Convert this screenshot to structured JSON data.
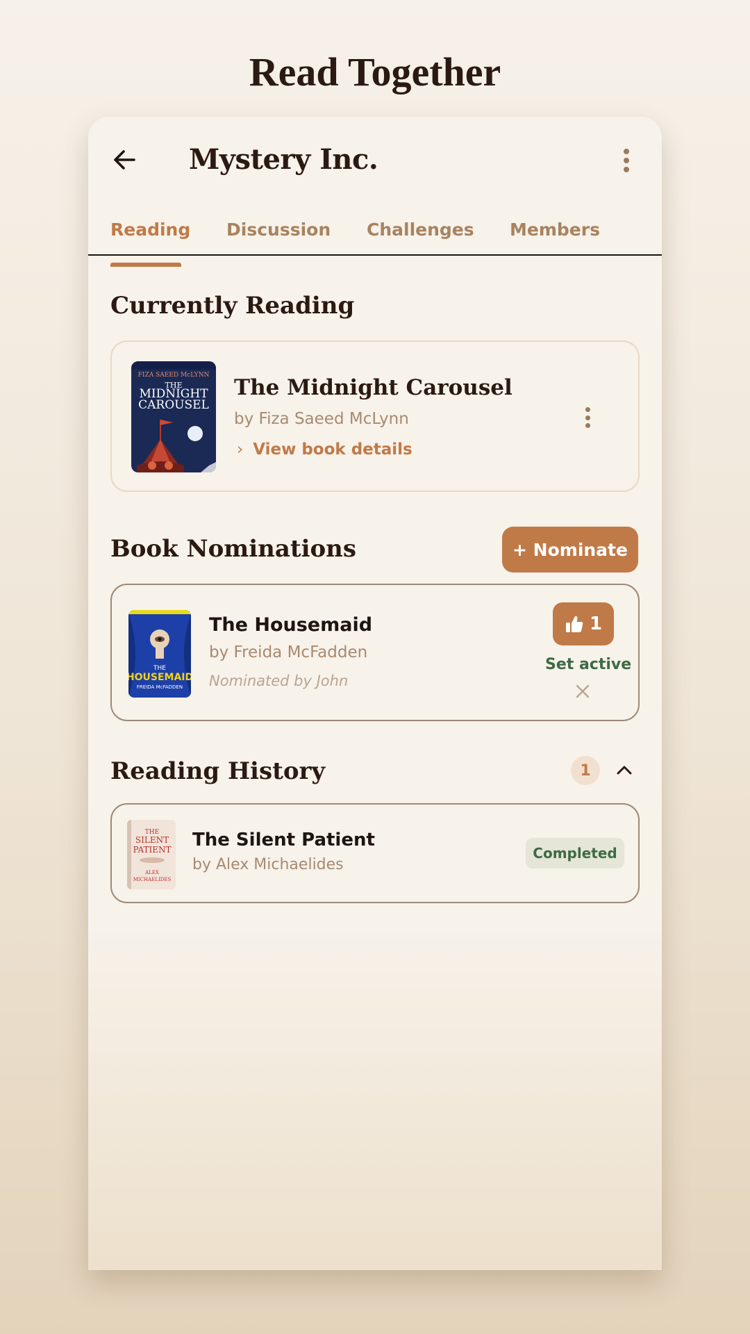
{
  "page": {
    "title": "Read Together"
  },
  "appbar": {
    "group_name": "Mystery Inc."
  },
  "tabs": [
    {
      "label": "Reading",
      "active": true
    },
    {
      "label": "Discussion",
      "active": false
    },
    {
      "label": "Challenges",
      "active": false
    },
    {
      "label": "Members",
      "active": false
    }
  ],
  "currently_reading": {
    "section_title": "Currently Reading",
    "book": {
      "title": "The Midnight Carousel",
      "author": "by Fiza Saeed McLynn",
      "details_link": "View book details",
      "cover": {
        "author_text": "FIZA SAEED McLYNN",
        "title_line1": "THE",
        "title_line2": "MIDNIGHT",
        "title_line3": "CAROUSEL"
      }
    }
  },
  "nominations": {
    "section_title": "Book Nominations",
    "nominate_label": "+ Nominate",
    "items": [
      {
        "title": "The Housemaid",
        "author": "by Freida McFadden",
        "nominated_by": "Nominated by John",
        "votes": "1",
        "set_active_label": "Set active",
        "cover": {
          "title_line1": "THE",
          "title_line2": "HOUSEMAID",
          "author_text": "FREIDA McFADDEN"
        }
      }
    ]
  },
  "history": {
    "section_title": "Reading History",
    "count": "1",
    "items": [
      {
        "title": "The Silent Patient",
        "author": "by Alex Michaelides",
        "status": "Completed",
        "cover": {
          "title_line1": "THE",
          "title_line2": "SILENT",
          "title_line3": "PATIENT",
          "author_line1": "ALEX",
          "author_line2": "MICHAELIDES"
        }
      }
    ]
  },
  "colors": {
    "accent": "#c07a48",
    "success": "#3f6a46",
    "background": "#f7f2ea",
    "text": "#2a1a12"
  },
  "icons": {
    "back": "arrow-left-icon",
    "more": "more-vertical-icon",
    "thumb": "thumbs-up-icon",
    "close": "close-icon",
    "chevron_up": "chevron-up-icon",
    "chevron_right": "chevron-right-icon"
  }
}
